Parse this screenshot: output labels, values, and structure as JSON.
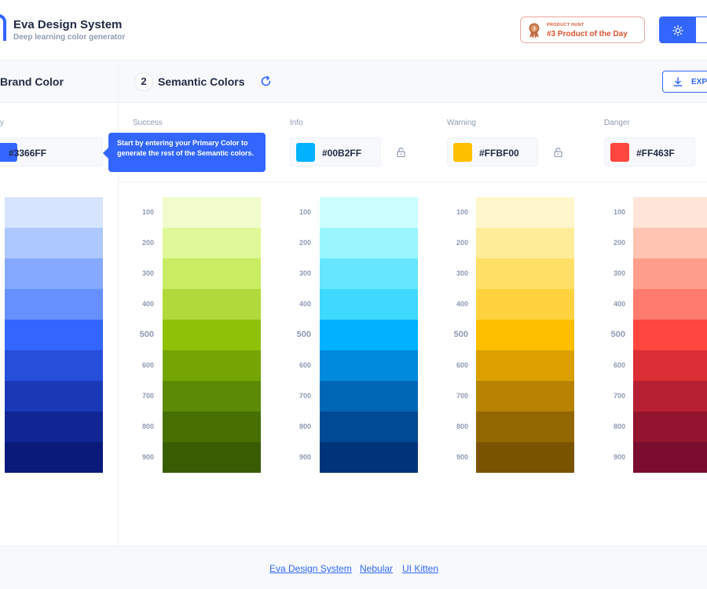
{
  "header": {
    "title": "Eva Design System",
    "subtitle": "Deep learning color generator",
    "badge": {
      "small": "PRODUCT HUNT",
      "big": "#3 Product of the Day",
      "medal": "3"
    }
  },
  "section": {
    "brand_title": "Brand Color",
    "step": "2",
    "semantic_title": "Semantic Colors",
    "export_label": "EXPO"
  },
  "brand": {
    "label": "y",
    "hex": "#3366FF",
    "swatch": "#3366FF"
  },
  "tooltip": {
    "text": "Start by entering your Primary Color to generate the rest of the Semantic colors."
  },
  "shades": [
    "100",
    "200",
    "300",
    "400",
    "500",
    "600",
    "700",
    "800",
    "900"
  ],
  "columns": [
    {
      "label": "Success",
      "hex": "",
      "swatch": ""
    },
    {
      "label": "Info",
      "hex": "#00B2FF",
      "swatch": "#00B2FF"
    },
    {
      "label": "Warning",
      "hex": "#FFBF00",
      "swatch": "#FFBF00"
    },
    {
      "label": "Danger",
      "hex": "#FF463F",
      "swatch": "#FF463F"
    }
  ],
  "palettes": {
    "primary": [
      "#d6e4ff",
      "#adc8ff",
      "#84a9ff",
      "#6690ff",
      "#3366ff",
      "#254edb",
      "#1939b7",
      "#102693",
      "#091a7a"
    ],
    "success": [
      "#f0fccb",
      "#dff898",
      "#c9ec63",
      "#b1d93b",
      "#8fc108",
      "#75a505",
      "#5d8a04",
      "#476f02",
      "#385c01"
    ],
    "info": [
      "#ccfeff",
      "#99f6ff",
      "#66e7ff",
      "#3fd9ff",
      "#00b2ff",
      "#008adb",
      "#0067b7",
      "#004993",
      "#00347a"
    ],
    "warning": [
      "#fff7cc",
      "#ffec99",
      "#ffdf66",
      "#ffd23f",
      "#ffbf00",
      "#dba000",
      "#b78300",
      "#936700",
      "#7a5300"
    ],
    "danger": [
      "#ffe5d8",
      "#ffc5b2",
      "#ff9f8b",
      "#ff7b6e",
      "#ff463f",
      "#db2e35",
      "#b71f33",
      "#93142f",
      "#7a0c2d"
    ]
  },
  "footer": {
    "links": [
      "Eva Design System",
      "Nebular",
      "UI Kitten"
    ]
  },
  "colors": {
    "accent": "#3366ff",
    "badge": "#da552f"
  },
  "icons": [
    "logo-icon",
    "medal-icon",
    "sun-icon",
    "refresh-icon",
    "download-icon",
    "lock-icon"
  ]
}
